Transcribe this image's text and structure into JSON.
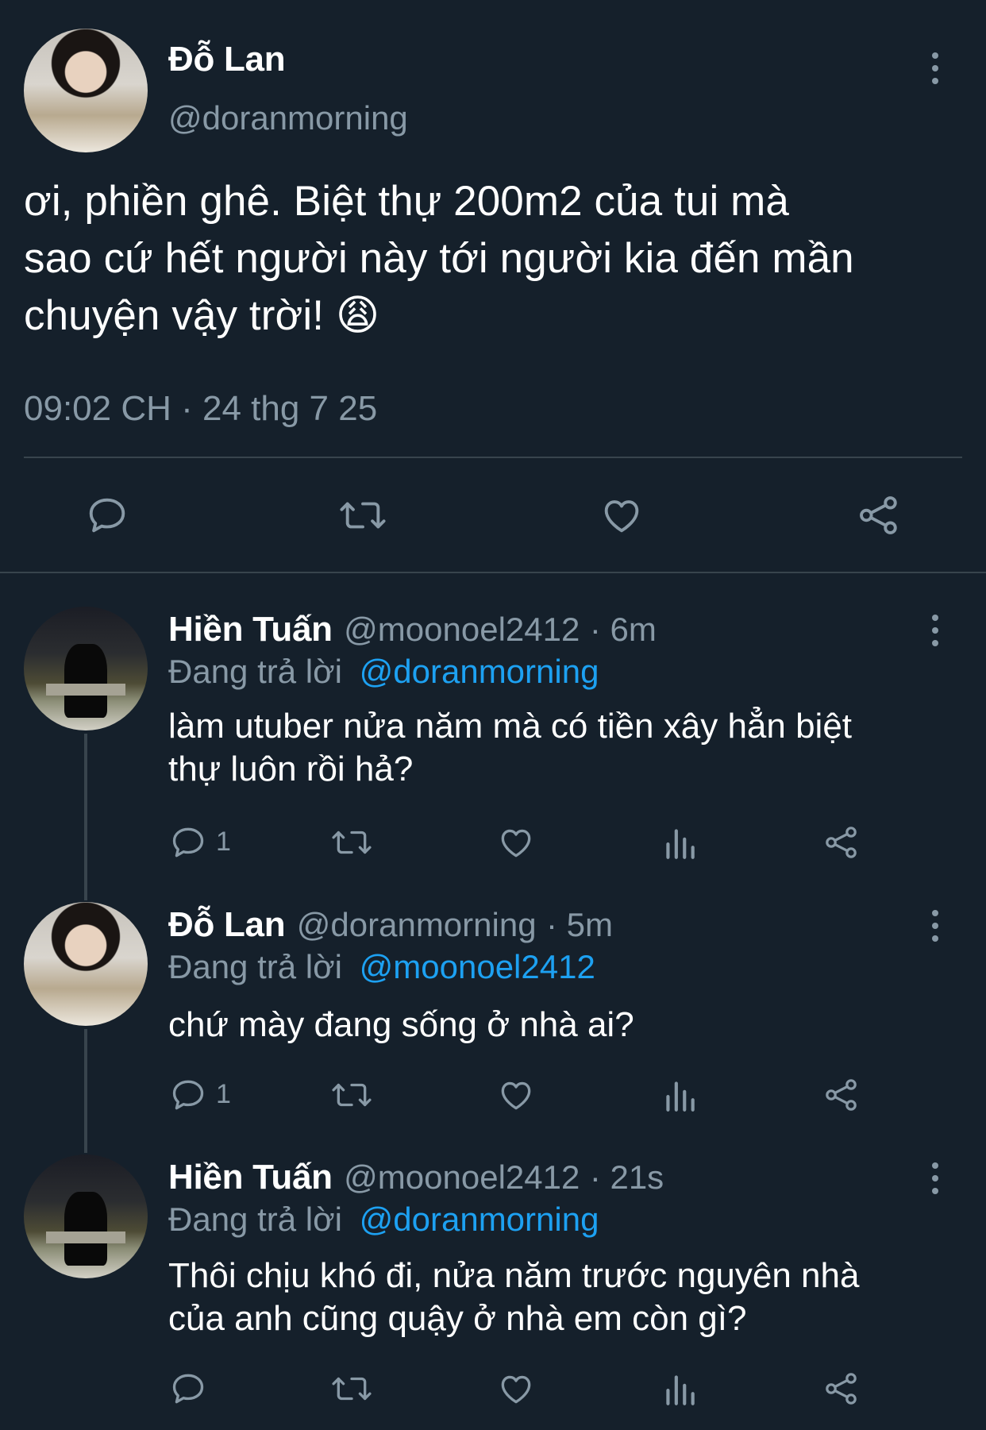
{
  "main_tweet": {
    "name": "Đỗ Lan",
    "handle": "@doranmorning",
    "text_line1": "ơi, phiền ghê. Biệt thự 200m2 của tui mà",
    "text_line2": "sao cứ hết người này tới người kia đến mần",
    "text_line3": "chuyện vậy trời!",
    "emoji": "😩",
    "timestamp": "09:02 CH · 24 thg 7 25",
    "actions": {
      "reply": "reply-icon",
      "retweet": "retweet-icon",
      "like": "heart-icon",
      "share": "share-icon"
    }
  },
  "replies": [
    {
      "name": "Hiền Tuấn",
      "handle": "@moonoel2412",
      "time": "· 6m",
      "replying_prefix": "Đang trả lời",
      "replying_to": "@doranmorning",
      "text_line1": "làm utuber nửa năm mà có tiền xây hẳn biệt",
      "text_line2": "thự luôn rồi hả?",
      "reply_count": "1"
    },
    {
      "name": "Đỗ Lan",
      "handle": "@doranmorning",
      "time": "· 5m",
      "replying_prefix": "Đang trả lời",
      "replying_to": "@moonoel2412",
      "text_line1": "chứ mày đang sống ở nhà ai?",
      "reply_count": "1"
    },
    {
      "name": "Hiền Tuấn",
      "handle": "@moonoel2412",
      "time": "· 21s",
      "replying_prefix": "Đang trả lời",
      "replying_to": "@doranmorning",
      "text_line1": "Thôi chịu khó đi, nửa năm trước nguyên nhà",
      "text_line2": "của anh cũng quậy ở nhà em còn gì?"
    }
  ],
  "colors": {
    "background": "#15202b",
    "muted": "#8899a6",
    "link": "#1da1f2",
    "divider": "#38444d"
  }
}
